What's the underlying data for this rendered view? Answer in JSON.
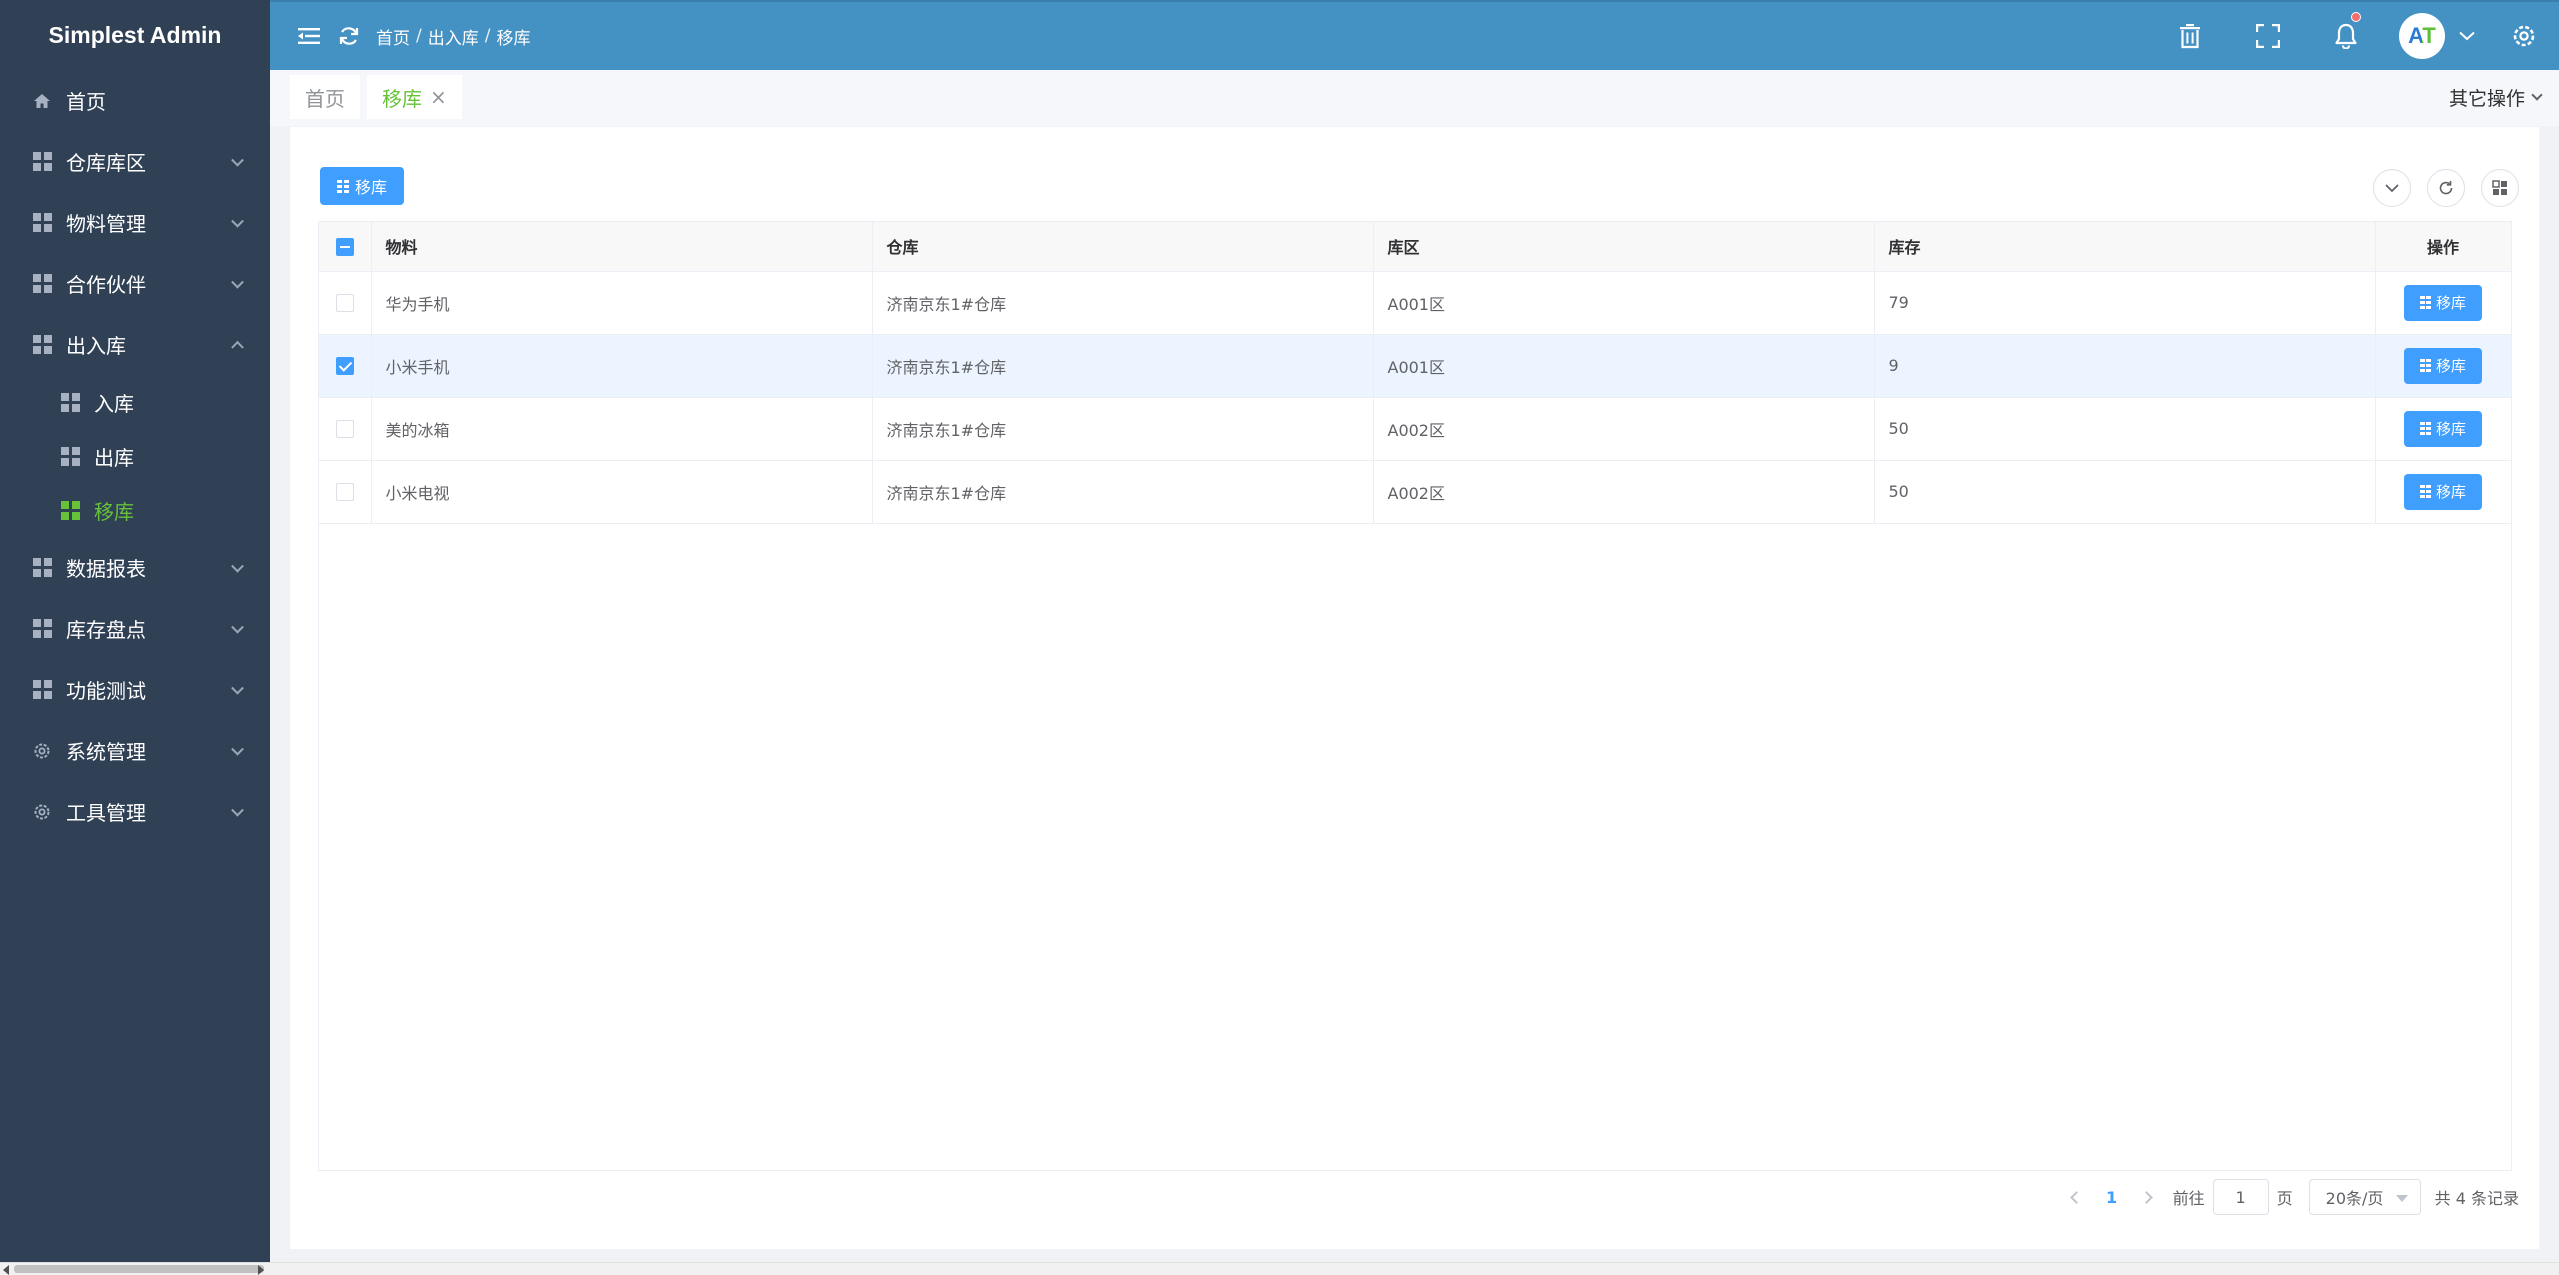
{
  "app": {
    "title": "Simplest Admin"
  },
  "sidebar": {
    "items": [
      {
        "label": "首页",
        "icon": "home-icon"
      },
      {
        "label": "仓库库区",
        "icon": "grid-icon"
      },
      {
        "label": "物料管理",
        "icon": "grid-icon"
      },
      {
        "label": "合作伙伴",
        "icon": "grid-icon"
      },
      {
        "label": "出入库",
        "icon": "grid-icon",
        "expanded": true
      },
      {
        "label": "数据报表",
        "icon": "grid-icon"
      },
      {
        "label": "库存盘点",
        "icon": "grid-icon"
      },
      {
        "label": "功能测试",
        "icon": "grid-icon"
      },
      {
        "label": "系统管理",
        "icon": "gear-icon"
      },
      {
        "label": "工具管理",
        "icon": "gear-icon"
      }
    ],
    "subitems": [
      {
        "label": "入库"
      },
      {
        "label": "出库"
      },
      {
        "label": "移库",
        "active": true
      }
    ]
  },
  "header": {
    "breadcrumb": [
      "首页",
      "出入库",
      "移库"
    ],
    "avatar_text": "AT"
  },
  "tabs": [
    {
      "label": "首页"
    },
    {
      "label": "移库",
      "active": true,
      "close": "×"
    }
  ],
  "other_ops": "其它操作",
  "toolbar": {
    "move_label": "移库"
  },
  "table": {
    "columns": [
      "物料",
      "仓库",
      "库区",
      "库存",
      "操作"
    ],
    "rows": [
      {
        "material": "华为手机",
        "warehouse": "济南京东1#仓库",
        "area": "A001区",
        "stock": "79",
        "checked": false,
        "op": "移库"
      },
      {
        "material": "小米手机",
        "warehouse": "济南京东1#仓库",
        "area": "A001区",
        "stock": "9",
        "checked": true,
        "op": "移库"
      },
      {
        "material": "美的冰箱",
        "warehouse": "济南京东1#仓库",
        "area": "A002区",
        "stock": "50",
        "checked": false,
        "op": "移库"
      },
      {
        "material": "小米电视",
        "warehouse": "济南京东1#仓库",
        "area": "A002区",
        "stock": "50",
        "checked": false,
        "op": "移库"
      }
    ]
  },
  "pagination": {
    "current": "1",
    "goto_label": "前往",
    "goto_value": "1",
    "page_unit": "页",
    "page_size": "20条/页",
    "total": "共 4 条记录"
  },
  "colors": {
    "sidebar": "#304156",
    "header": "#4491c4",
    "primary": "#409eff",
    "active": "#67c23a"
  }
}
